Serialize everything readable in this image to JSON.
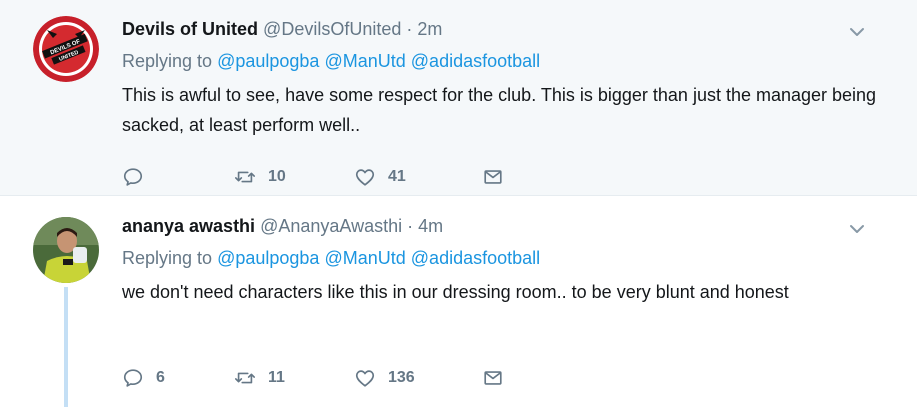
{
  "tweets": [
    {
      "name": "Devils of United",
      "handle": "@DevilsOfUnited",
      "separator": "·",
      "time": "2m",
      "replying_prefix": "Replying to",
      "mentions": [
        "@paulpogba",
        "@ManUtd",
        "@adidasfootball"
      ],
      "text": "This is awful to see, have some respect for the club. This is bigger than just the manager being sacked, at least perform well..",
      "reply_count": "",
      "retweet_count": "10",
      "like_count": "41",
      "avatar_text_top": "DEVILS OF",
      "avatar_text_bottom": "UNITED"
    },
    {
      "name": "ananya awasthi",
      "handle": "@AnanyaAwasthi",
      "separator": "·",
      "time": "4m",
      "replying_prefix": "Replying to",
      "mentions": [
        "@paulpogba",
        "@ManUtd",
        "@adidasfootball"
      ],
      "text": "we don't need characters like this in our dressing room.. to be very blunt and honest",
      "reply_count": "6",
      "retweet_count": "11",
      "like_count": "136"
    }
  ],
  "colors": {
    "link": "#1b95e0",
    "muted": "#657786",
    "text": "#14171a",
    "highlight_bg": "#f5f8fa",
    "thread_line": "#c4dff5"
  },
  "icons": [
    "reply-icon",
    "retweet-icon",
    "like-icon",
    "message-icon",
    "chevron-down-icon"
  ]
}
